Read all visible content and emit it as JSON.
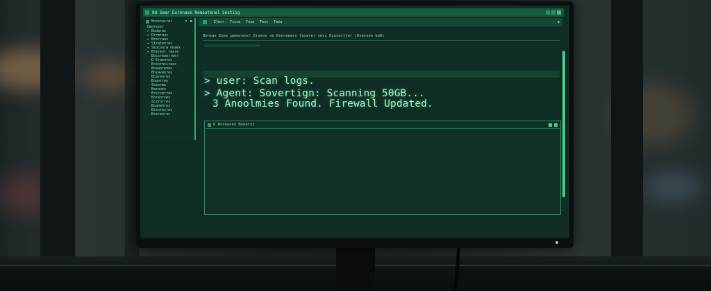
{
  "window": {
    "title": "88 Sear Esronase Remootenal Sestiig"
  },
  "sidebar": {
    "header": "Borerwsrer",
    "header_ctrl": "▾ ▪",
    "items": [
      "Emoreser",
      "▸ Bodaraz",
      "▸ Drrmraos",
      "▸ Brerraos",
      "▸ Stratenres",
      "▸ Ssoconra nbaex",
      "▸ Brereor raare",
      "  Bocsreaerreer",
      "  D Sraentes",
      "  Ecsornsiroes",
      "  Bosaorenes",
      "  Bnsavanres",
      "  Bcarenres",
      "  Boaorres",
      "  Sseorme",
      "  Barones",
      "  Ecsrcerres",
      "  Borenrves",
      "  Scsrorres",
      "  Bcaoenres",
      "  Brsorecres",
      "  Bssrenres"
    ]
  },
  "menubar": {
    "items": [
      "Elesr",
      "Tssca",
      "Tosa",
      "Tess",
      "Teea"
    ],
    "right": "▪"
  },
  "info_line": "Bonsas Eeas ganensos! Erseos se Dsoreeass fuzarer sesz Esoseitler (Dsessoe ba6)",
  "terminal": {
    "line1": "> user: Scan logs.",
    "line2": "> Agent: Sovertign: Scanning 50GB...",
    "line3": "3 Anoolmies Found. Firewall Updated."
  },
  "panel": {
    "title": "8 Bsseunez Bsearsz"
  },
  "colors": {
    "screen_bg": "#0f2d24",
    "accent": "#3bd486",
    "text": "#9ff5c4",
    "titlebar": "#145c3e"
  }
}
